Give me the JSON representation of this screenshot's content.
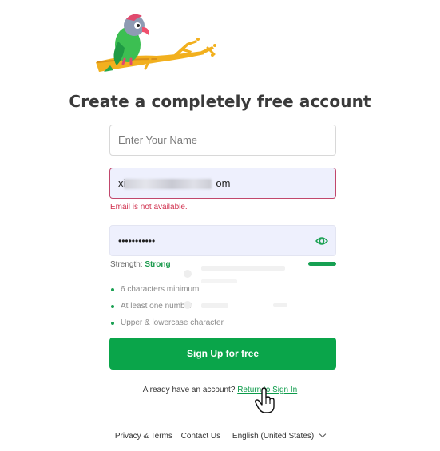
{
  "logo": {
    "name": "parrot-on-branch-logo"
  },
  "title": "Create a completely free account",
  "form": {
    "name_placeholder": "Enter Your Name",
    "email_prefix": "xi",
    "email_suffix": "om",
    "email_error": "Email is not available.",
    "password_mask": "•••••••••••",
    "password_toggle_icon": "eye-icon",
    "strength_label": "Strength:",
    "strength_value": "Strong",
    "strength_level": 1.0,
    "rules": [
      "6 characters minimum",
      "At least one number",
      "Upper & lowercase character"
    ],
    "submit_label": "Sign Up for free"
  },
  "signin": {
    "prompt": "Already have an account?",
    "link": "Return to Sign In"
  },
  "footer": {
    "privacy": "Privacy & Terms",
    "contact": "Contact Us",
    "language": "English (United States)"
  },
  "colors": {
    "accent": "#0aa54a",
    "error": "#d0304e",
    "field_fill": "#eef0fd"
  }
}
